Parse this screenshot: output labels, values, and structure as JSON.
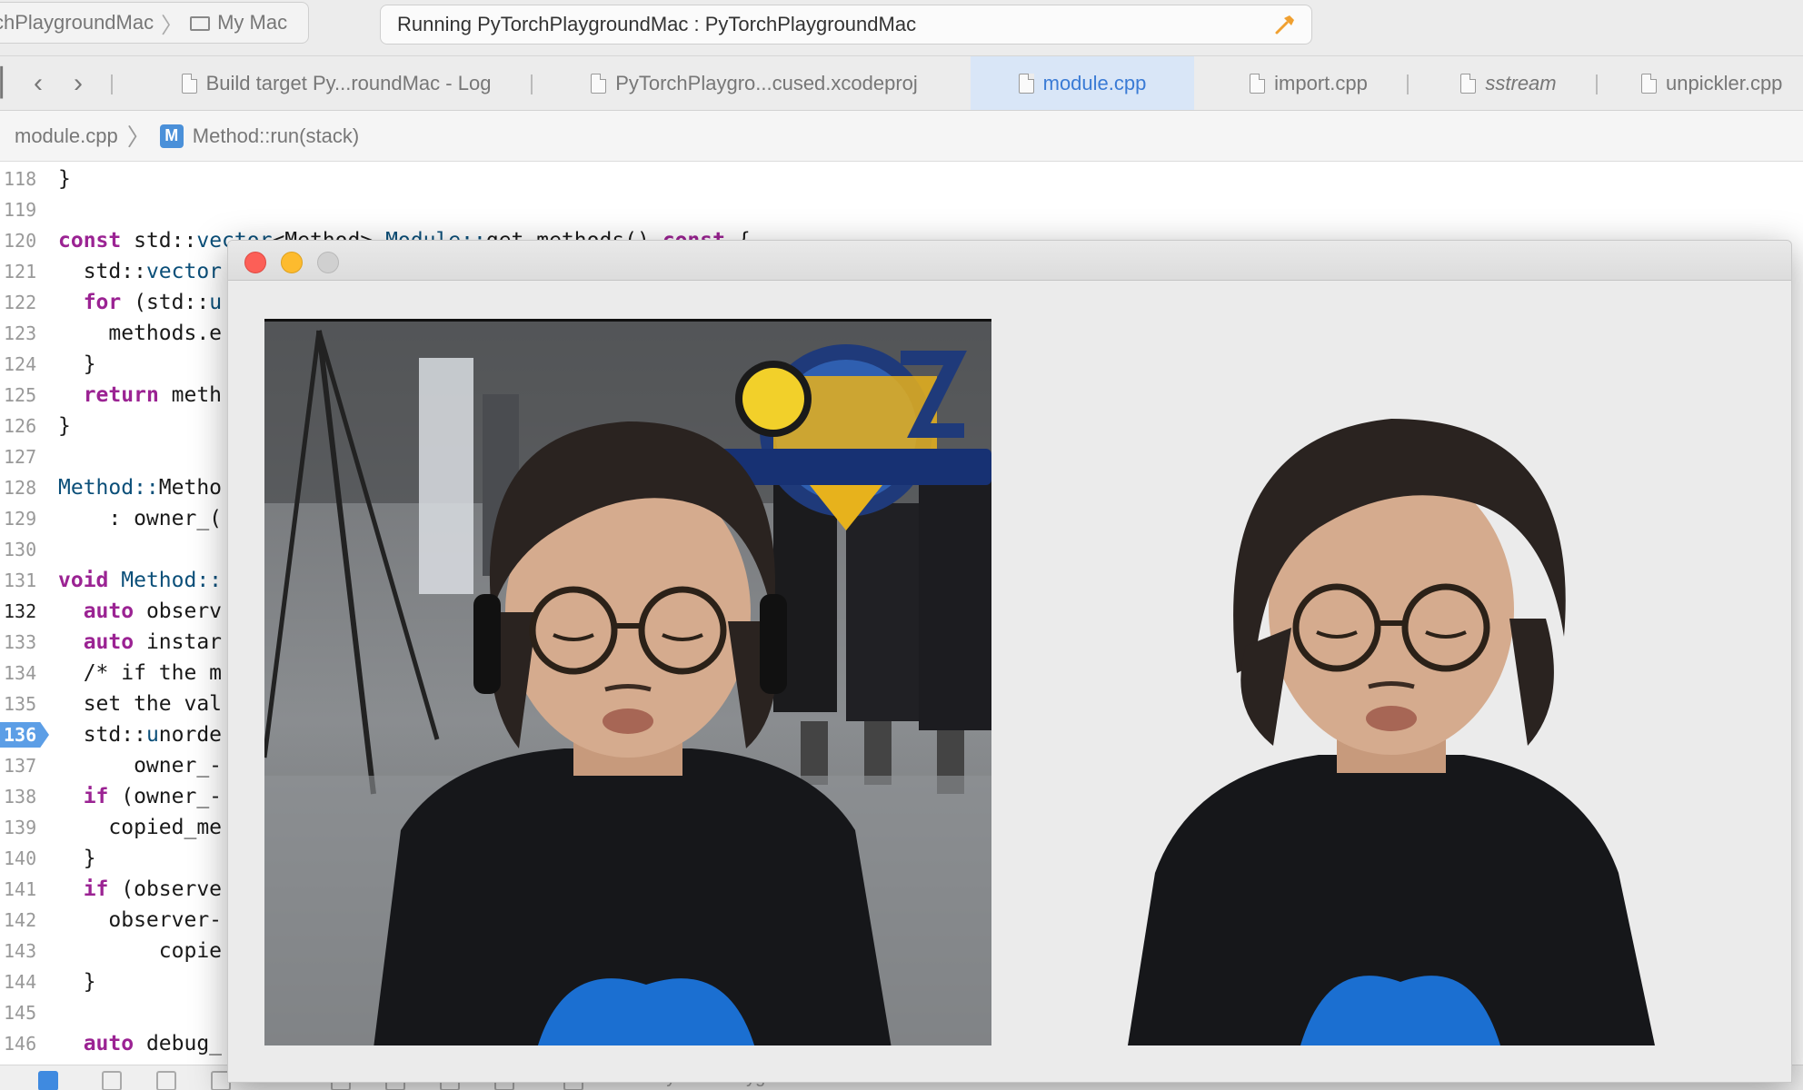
{
  "toolbar": {
    "scheme_project": "chPlaygroundMac",
    "scheme_destination": "My Mac",
    "status_text": "Running PyTorchPlaygroundMac : PyTorchPlaygroundMac"
  },
  "tabs": [
    {
      "label": "Build target Py...roundMac - Log"
    },
    {
      "label": "PyTorchPlaygro...cused.xcodeproj"
    },
    {
      "label": "module.cpp"
    },
    {
      "label": "import.cpp"
    },
    {
      "label": "sstream"
    },
    {
      "label": "unpickler.cpp"
    }
  ],
  "jumpbar": {
    "file": "module.cpp",
    "badge": "M",
    "symbol": "Method::run(stack)"
  },
  "code": [
    {
      "n": "118",
      "t": "}"
    },
    {
      "n": "119",
      "t": ""
    },
    {
      "n": "120",
      "t": "const std::vector<Method> Module::get_methods() const {"
    },
    {
      "n": "121",
      "t": "  std::vector"
    },
    {
      "n": "122",
      "t": "  for (std::u"
    },
    {
      "n": "123",
      "t": "    methods.e"
    },
    {
      "n": "124",
      "t": "  }"
    },
    {
      "n": "125",
      "t": "  return meth"
    },
    {
      "n": "126",
      "t": "}"
    },
    {
      "n": "127",
      "t": ""
    },
    {
      "n": "128",
      "t": "Method::Metho"
    },
    {
      "n": "129",
      "t": "    : owner_("
    },
    {
      "n": "130",
      "t": ""
    },
    {
      "n": "131",
      "t": "void Method::"
    },
    {
      "n": "132",
      "t": "  auto observ"
    },
    {
      "n": "133",
      "t": "  auto instar"
    },
    {
      "n": "134",
      "t": "  /* if the m"
    },
    {
      "n": "135",
      "t": "  set the val"
    },
    {
      "n": "136",
      "t": "  std::unorde"
    },
    {
      "n": "137",
      "t": "      owner_-"
    },
    {
      "n": "138",
      "t": "  if (owner_-"
    },
    {
      "n": "139",
      "t": "    copied_me"
    },
    {
      "n": "140",
      "t": "  }"
    },
    {
      "n": "141",
      "t": "  if (observe"
    },
    {
      "n": "142",
      "t": "    observer-"
    },
    {
      "n": "143",
      "t": "        copie"
    },
    {
      "n": "144",
      "t": "  }"
    },
    {
      "n": "145",
      "t": ""
    },
    {
      "n": "146",
      "t": "  auto debug_"
    }
  ],
  "current_line": "132",
  "breakpoint_line": "136",
  "debugbar": {
    "target_label": "PyTorchPlaygroundMac"
  },
  "window": {
    "original_image_desc": "webcam frame",
    "segmented_image_desc": "person cutout"
  },
  "colors": {
    "accent_blue": "#3a7bd5",
    "breakpoint": "#5c9ee6",
    "keyword": "#9b2393",
    "type": "#0b4f79"
  }
}
